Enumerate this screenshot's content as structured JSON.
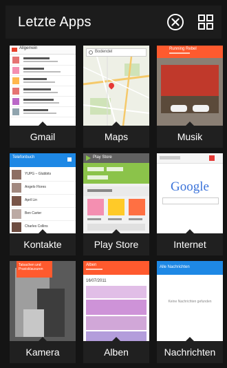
{
  "header": {
    "title": "Letzte Apps",
    "close_icon": "close-circle-icon",
    "grid_icon": "grid-view-icon"
  },
  "apps": [
    {
      "label": "Gmail"
    },
    {
      "label": "Maps"
    },
    {
      "label": "Musik"
    },
    {
      "label": "Kontakte"
    },
    {
      "label": "Play Store"
    },
    {
      "label": "Internet"
    },
    {
      "label": "Kamera"
    },
    {
      "label": "Alben"
    },
    {
      "label": "Nachrichten"
    }
  ],
  "thumbs": {
    "gmail_bar": "Allgemein",
    "maps_search": "Bodendel",
    "musik_bar": "Running Rebel",
    "kontakte_bar": "Telefonbuch",
    "kontakte_names": [
      "YUPG – Glubbits",
      "Angelo Flores",
      "April Lin",
      "Ben Carter",
      "Charles Collins"
    ],
    "playstore_bar": "Play Store",
    "internet_logo": "Google",
    "kamera_banner": "Tatsachen und Praxisklausuren",
    "alben_bar": "Alben",
    "alben_date": "16/07/2011",
    "nachrichten_bar": "Alle Nachrichten",
    "nachrichten_empty": "Keine Nachrichten gefunden"
  },
  "colors": {
    "accent": "#ff5a2e",
    "gmail_red": "#e8402a",
    "blue": "#2196f3",
    "green": "#8bc34a"
  }
}
